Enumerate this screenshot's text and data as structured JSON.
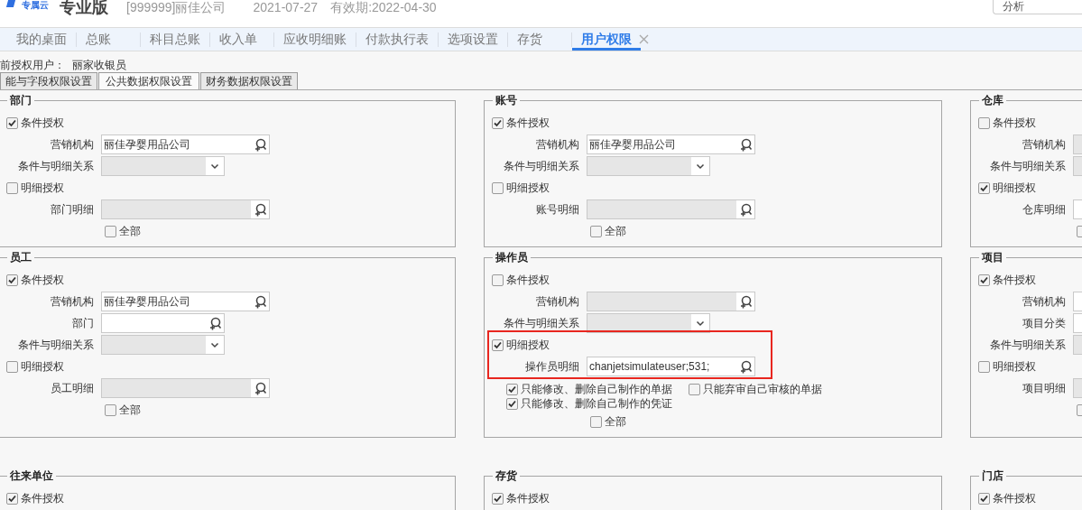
{
  "header": {
    "logo_text": "专属云",
    "edition": "专业版",
    "company": "[999999]丽佳公司",
    "date": "2021-07-27",
    "validity": "有效期:2022-04-30",
    "search_value": "分析"
  },
  "tabs": [
    {
      "label": "我的桌面",
      "selected": false,
      "closable": false
    },
    {
      "label": "总账",
      "selected": false,
      "closable": false
    },
    {
      "label": "科目总账",
      "selected": false,
      "closable": false
    },
    {
      "label": "收入单",
      "selected": false,
      "closable": false
    },
    {
      "label": "应收明细账",
      "selected": false,
      "closable": false
    },
    {
      "label": "付款执行表",
      "selected": false,
      "closable": false
    },
    {
      "label": "选项设置",
      "selected": false,
      "closable": false
    },
    {
      "label": "存货",
      "selected": false,
      "closable": false
    },
    {
      "label": "用户权限",
      "selected": true,
      "closable": true
    }
  ],
  "user_line": {
    "label": "前授权用户：",
    "value": "丽家收银员"
  },
  "subtabs": [
    {
      "label": "能与字段权限设置",
      "selected": false
    },
    {
      "label": "公共数据权限设置",
      "selected": true
    },
    {
      "label": "财务数据权限设置",
      "selected": false
    }
  ],
  "panel_rows": [
    [
      {
        "title": "部门",
        "highlighted": false,
        "items": [
          {
            "kind": "checkbox",
            "label": "条件授权",
            "checked": true
          },
          {
            "kind": "lookup",
            "label": "营销机构",
            "value": "丽佳孕婴用品公司",
            "disabled": false
          },
          {
            "kind": "select",
            "label": "条件与明细关系",
            "disabled": true
          },
          {
            "kind": "checkbox",
            "label": "明细授权",
            "checked": false
          },
          {
            "kind": "lookup",
            "label": "部门明细",
            "disabled": true
          },
          {
            "kind": "all",
            "label": "全部",
            "checked": false
          }
        ]
      },
      {
        "title": "账号",
        "highlighted": false,
        "items": [
          {
            "kind": "checkbox",
            "label": "条件授权",
            "checked": true
          },
          {
            "kind": "lookup",
            "label": "营销机构",
            "value": "丽佳孕婴用品公司",
            "disabled": false
          },
          {
            "kind": "select",
            "label": "条件与明细关系",
            "disabled": true
          },
          {
            "kind": "checkbox",
            "label": "明细授权",
            "checked": false
          },
          {
            "kind": "lookup",
            "label": "账号明细",
            "disabled": true
          },
          {
            "kind": "all",
            "label": "全部",
            "checked": false
          }
        ]
      },
      {
        "title": "仓库",
        "highlighted": false,
        "items": [
          {
            "kind": "checkbox",
            "label": "条件授权",
            "checked": false
          },
          {
            "kind": "lookup",
            "label": "营销机构",
            "disabled": true
          },
          {
            "kind": "select",
            "label": "条件与明细关系",
            "disabled": true
          },
          {
            "kind": "checkbox",
            "label": "明细授权",
            "checked": true
          },
          {
            "kind": "lookup",
            "label": "仓库明细",
            "disabled": false
          },
          {
            "kind": "all",
            "checked": false
          }
        ]
      }
    ],
    [
      {
        "title": "员工",
        "highlighted": false,
        "items": [
          {
            "kind": "checkbox",
            "label": "条件授权",
            "checked": true
          },
          {
            "kind": "lookup",
            "label": "营销机构",
            "value": "丽佳孕婴用品公司",
            "disabled": false
          },
          {
            "kind": "short_lookup",
            "label": "部门",
            "disabled": false
          },
          {
            "kind": "select",
            "label": "条件与明细关系",
            "disabled": true
          },
          {
            "kind": "checkbox",
            "label": "明细授权",
            "checked": false
          },
          {
            "kind": "lookup",
            "label": "员工明细",
            "disabled": true
          },
          {
            "kind": "all",
            "label": "全部",
            "checked": false
          }
        ]
      },
      {
        "title": "操作员",
        "highlighted": true,
        "items": [
          {
            "kind": "checkbox",
            "label": "条件授权",
            "checked": false
          },
          {
            "kind": "lookup",
            "label": "营销机构",
            "disabled": true
          },
          {
            "kind": "select",
            "label": "条件与明细关系",
            "disabled": true
          },
          {
            "kind": "checkbox",
            "label": "明细授权",
            "checked": true
          },
          {
            "kind": "lookup",
            "label": "操作员明细",
            "value": "chanjetsimulateuser;531;",
            "disabled": false
          },
          {
            "kind": "options",
            "options": [
              {
                "label": "只能修改、删除自己制作的单据",
                "checked": true
              },
              {
                "label": "只能弃审自己审核的单据",
                "checked": false
              },
              {
                "label": "只能修改、删除自己制作的凭证",
                "checked": true
              }
            ]
          },
          {
            "kind": "all",
            "label": "全部",
            "checked": false
          }
        ]
      },
      {
        "title": "项目",
        "highlighted": false,
        "items": [
          {
            "kind": "checkbox",
            "label": "条件授权",
            "checked": true
          },
          {
            "kind": "lookup",
            "label": "营销机构",
            "disabled": false
          },
          {
            "kind": "short_lookup",
            "label": "项目分类",
            "disabled": false
          },
          {
            "kind": "select",
            "label": "条件与明细关系",
            "disabled": true
          },
          {
            "kind": "checkbox",
            "label": "明细授权",
            "checked": false
          },
          {
            "kind": "lookup",
            "label": "项目明细",
            "disabled": true
          },
          {
            "kind": "all",
            "checked": false
          }
        ]
      }
    ],
    [
      {
        "title": "往来单位",
        "highlighted": false,
        "items": [
          {
            "kind": "checkbox",
            "label": "条件授权",
            "checked": true
          }
        ]
      },
      {
        "title": "存货",
        "highlighted": false,
        "items": [
          {
            "kind": "checkbox",
            "label": "条件授权",
            "checked": true
          }
        ]
      },
      {
        "title": "门店",
        "highlighted": false,
        "items": [
          {
            "kind": "checkbox",
            "label": "条件授权",
            "checked": true
          }
        ]
      }
    ]
  ]
}
